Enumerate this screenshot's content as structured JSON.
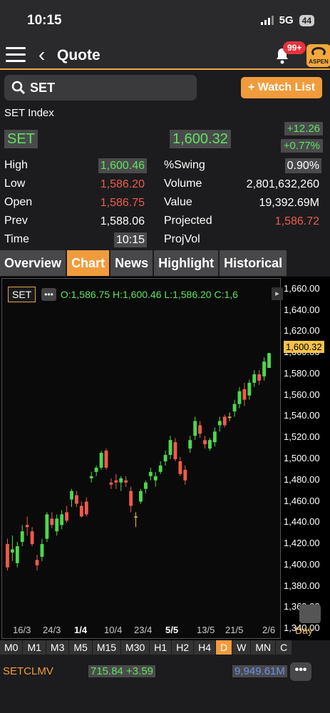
{
  "status": {
    "time": "10:15",
    "network": "5G",
    "battery": "44"
  },
  "header": {
    "title": "Quote",
    "badge": "99+",
    "logo": "ASPEN"
  },
  "search": {
    "value": "SET",
    "watch_label": "+ Watch List"
  },
  "quote": {
    "index_name": "SET Index",
    "symbol": "SET",
    "last": "1,600.32",
    "change": "+12.26",
    "percent": "+0.77%",
    "rows": [
      {
        "l1": "High",
        "v1": "1,600.46",
        "l2": "%Swing",
        "v2": "0.90%"
      },
      {
        "l1": "Low",
        "v1": "1,586.20",
        "l2": "Volume",
        "v2": "2,801,632,260"
      },
      {
        "l1": "Open",
        "v1": "1,586.75",
        "l2": "Value",
        "v2": "19,392.69M"
      },
      {
        "l1": "Prev",
        "v1": "1,588.06",
        "l2": "Projected",
        "v2": "1,586.72"
      },
      {
        "l1": "Time",
        "v1": "10:15",
        "l2": "ProjVol",
        "v2": ""
      }
    ]
  },
  "tabs": [
    "Overview",
    "Chart",
    "News",
    "Highlight",
    "Historical"
  ],
  "chart": {
    "symbol_tag": "SET",
    "dots": "•••",
    "ohlc": "O:1,586.75  H:1,600.46  L:1,586.20  C:1,6",
    "current_label": "1,600.32",
    "y_ticks": [
      "1,660.00",
      "1,640.00",
      "1,620.00",
      "1,600.00",
      "1,580.00",
      "1,560.00",
      "1,540.00",
      "1,520.00",
      "1,500.00",
      "1,480.00",
      "1,460.00",
      "1,440.00",
      "1,420.00",
      "1,400.00",
      "1,380.00",
      "1,360.00",
      "1,340.00"
    ],
    "x_ticks": [
      "16/3",
      "24/3",
      "1/4",
      "10/4",
      "23/4",
      "5/5",
      "13/5",
      "21/5",
      "2/6"
    ],
    "day_label": "Day"
  },
  "chart_data": {
    "type": "candlestick",
    "ylim": [
      1330,
      1670
    ],
    "colors": {
      "up": "#4cd94c",
      "down": "#f05a4e",
      "flat": "#f0c040"
    },
    "candles": [
      [
        1420,
        1425,
        1395,
        1398
      ],
      [
        1412,
        1428,
        1404,
        1415
      ],
      [
        1402,
        1422,
        1398,
        1418
      ],
      [
        1422,
        1438,
        1418,
        1432
      ],
      [
        1438,
        1446,
        1428,
        1436
      ],
      [
        1432,
        1436,
        1418,
        1420
      ],
      [
        1405,
        1410,
        1395,
        1400
      ],
      [
        1408,
        1425,
        1404,
        1420
      ],
      [
        1425,
        1450,
        1422,
        1448
      ],
      [
        1444,
        1450,
        1435,
        1438
      ],
      [
        1432,
        1448,
        1428,
        1444
      ],
      [
        1438,
        1452,
        1434,
        1448
      ],
      [
        1450,
        1456,
        1440,
        1442
      ],
      [
        1462,
        1472,
        1455,
        1470
      ],
      [
        1466,
        1470,
        1455,
        1458
      ],
      [
        1456,
        1460,
        1445,
        1446
      ],
      [
        1460,
        1464,
        1446,
        1448
      ],
      [
        1482,
        1488,
        1478,
        1484
      ],
      [
        1488,
        1494,
        1484,
        1492
      ],
      [
        1492,
        1508,
        1490,
        1506
      ],
      [
        1508,
        1510,
        1490,
        1492
      ],
      [
        1478,
        1482,
        1472,
        1476
      ],
      [
        1480,
        1486,
        1472,
        1478
      ],
      [
        1478,
        1484,
        1470,
        1482
      ],
      [
        1480,
        1484,
        1474,
        1478
      ],
      [
        1470,
        1474,
        1450,
        1456
      ],
      [
        1446,
        1450,
        1436,
        1446
      ],
      [
        1460,
        1472,
        1458,
        1470
      ],
      [
        1472,
        1480,
        1468,
        1478
      ],
      [
        1484,
        1492,
        1480,
        1488
      ],
      [
        1480,
        1488,
        1474,
        1484
      ],
      [
        1488,
        1498,
        1486,
        1494
      ],
      [
        1498,
        1508,
        1494,
        1504
      ],
      [
        1504,
        1522,
        1500,
        1518
      ],
      [
        1516,
        1520,
        1498,
        1500
      ],
      [
        1498,
        1502,
        1484,
        1486
      ],
      [
        1490,
        1494,
        1476,
        1480
      ],
      [
        1510,
        1522,
        1506,
        1518
      ],
      [
        1522,
        1540,
        1518,
        1536
      ],
      [
        1532,
        1536,
        1520,
        1524
      ],
      [
        1518,
        1522,
        1510,
        1514
      ],
      [
        1510,
        1520,
        1508,
        1518
      ],
      [
        1516,
        1530,
        1512,
        1526
      ],
      [
        1532,
        1540,
        1526,
        1536
      ],
      [
        1540,
        1542,
        1530,
        1532
      ],
      [
        1540,
        1544,
        1536,
        1540
      ],
      [
        1545,
        1556,
        1540,
        1552
      ],
      [
        1552,
        1568,
        1548,
        1564
      ],
      [
        1566,
        1572,
        1550,
        1556
      ],
      [
        1560,
        1575,
        1556,
        1572
      ],
      [
        1572,
        1584,
        1568,
        1580
      ],
      [
        1580,
        1584,
        1570,
        1574
      ],
      [
        1578,
        1596,
        1574,
        1592
      ],
      [
        1586,
        1600,
        1586,
        1600
      ]
    ]
  },
  "timeframes": [
    "M0",
    "M1",
    "M3",
    "M5",
    "M15",
    "M30",
    "H1",
    "H2",
    "H4",
    "D",
    "W",
    "MN",
    "C"
  ],
  "bottom": {
    "symbol": "SETCLMV",
    "price": "715.84 +3.59",
    "value": "9,949.61M",
    "more": "•••"
  }
}
